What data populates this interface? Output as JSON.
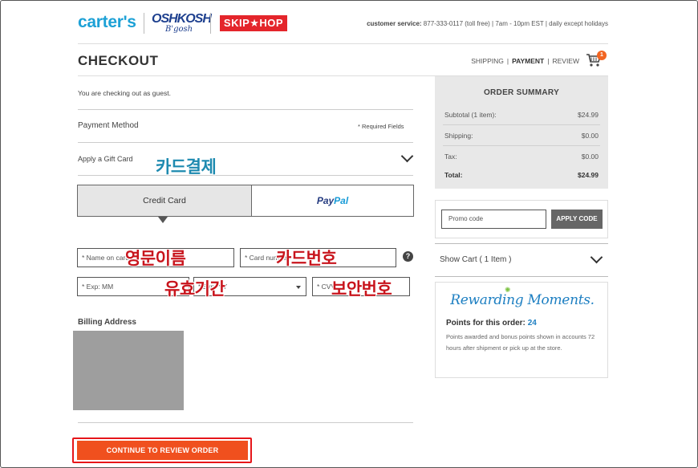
{
  "header": {
    "brands": {
      "carters": "carter's",
      "oshkosh": "OSHKOSH",
      "oshkosh_sub": "B'gosh",
      "skiphop": "SKIP★HOP"
    },
    "customer_service_label": "customer service:",
    "customer_service_text": "877-333-0117 (toll free) | 7am - 10pm EST | daily except holidays"
  },
  "checkout": {
    "title": "CHECKOUT",
    "steps": [
      "SHIPPING",
      "PAYMENT",
      "REVIEW"
    ],
    "current_step": "PAYMENT",
    "cart_count": "1"
  },
  "left": {
    "guest_text": "You are checking out as guest.",
    "payment_method_label": "Payment Method",
    "required_fields": "* Required Fields",
    "gift_card_label": "Apply a Gift Card",
    "tabs": {
      "credit_card": "Credit Card",
      "paypal_1": "Pay",
      "paypal_2": "Pal"
    },
    "fields": {
      "name_on_card": "* Name on card",
      "card_number": "* Card number",
      "exp_mm": "* Exp: MM",
      "exp_yy": "* Exp: YY",
      "cvv": "* CVV"
    },
    "help_glyph": "?",
    "billing_address": "Billing Address",
    "continue_button": "CONTINUE TO REVIEW ORDER"
  },
  "summary": {
    "title": "ORDER SUMMARY",
    "rows": [
      {
        "label": "Subtotal (1 item):",
        "value": "$24.99"
      },
      {
        "label": "Shipping:",
        "value": "$0.00"
      },
      {
        "label": "Tax:",
        "value": "$0.00"
      },
      {
        "label": "Total:",
        "value": "$24.99"
      }
    ]
  },
  "promo": {
    "placeholder": "Promo code",
    "button": "APPLY CODE"
  },
  "show_cart": "Show Cart ( 1 Item )",
  "rewards": {
    "logo": "Rewarding Moments.",
    "points_label": "Points for this order:",
    "points_value": "24",
    "note": "Points awarded and bonus points shown in accounts 72 hours after shipment or pick up at the store."
  },
  "annotations": {
    "card_payment": "카드결제",
    "english_name": "영문이름",
    "card_number": "카드번호",
    "expiry": "유효기간",
    "security_code": "보안번호"
  },
  "colors": {
    "accent_orange": "#f0501e",
    "highlight_red": "#e6161a",
    "carters_blue": "#1da1d6",
    "oshkosh_navy": "#1d3f8e",
    "skiphop_red": "#e4252b",
    "summary_bg": "#e8e8e8"
  },
  "icons": {
    "cart": "shopping-cart-icon",
    "chevron": "chevron-down-icon",
    "help": "help-circle-icon",
    "select_arrow": "caret-down-icon"
  }
}
